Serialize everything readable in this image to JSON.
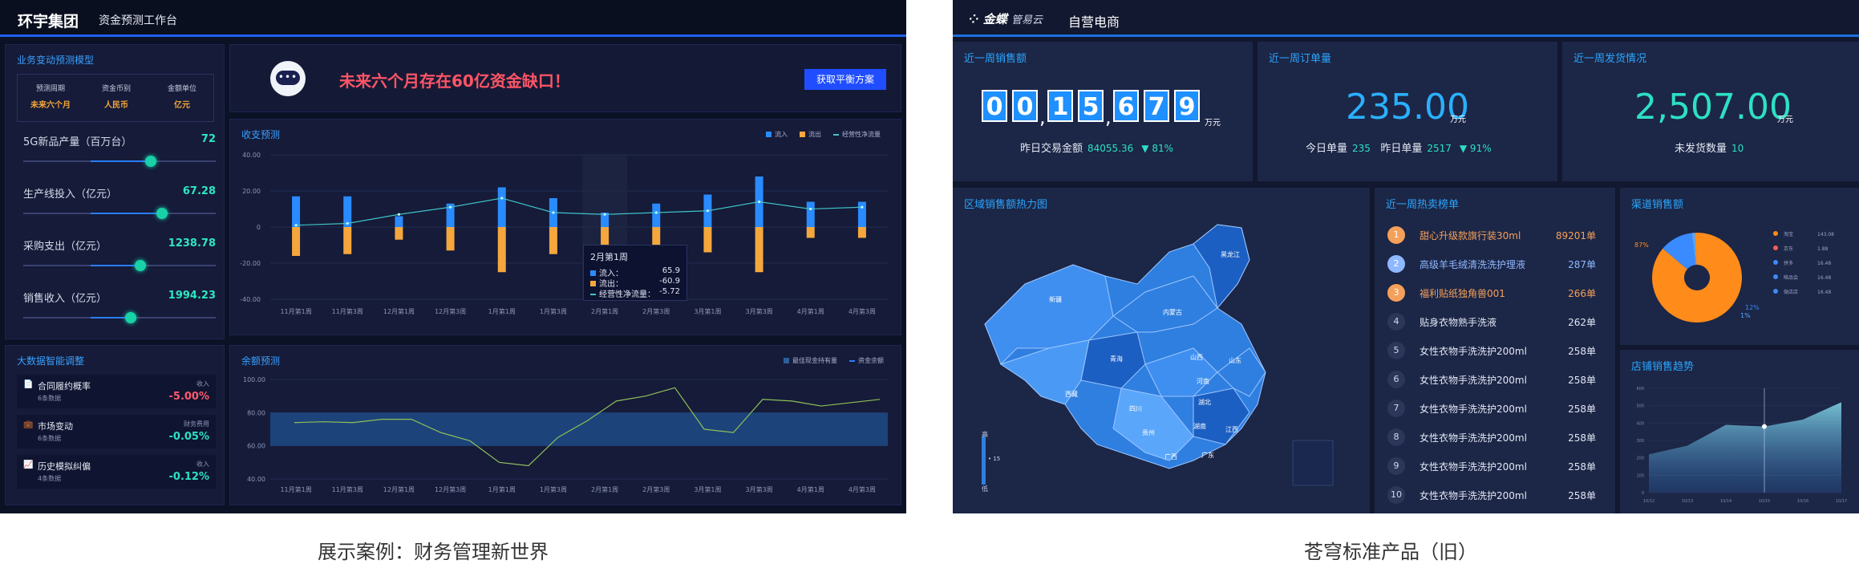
{
  "left": {
    "header": {
      "brand": "环宇集团",
      "subtitle": "资金预测工作台"
    },
    "model": {
      "title": "业务变动预测模型",
      "cols": [
        {
          "key": "预测周期",
          "val": "未来六个月"
        },
        {
          "key": "资金币别",
          "val": "人民币"
        },
        {
          "key": "金额单位",
          "val": "亿元"
        }
      ],
      "sliders": [
        {
          "label": "5G新品产量（百万台）",
          "value": "72",
          "level": 0.48
        },
        {
          "label": "生产线投入（亿元）",
          "value": "67.28",
          "level": 0.57
        },
        {
          "label": "采购支出（亿元）",
          "value": "1238.78",
          "level": 0.4
        },
        {
          "label": "销售收入（亿元）",
          "value": "1994.23",
          "level": 0.32
        }
      ]
    },
    "alert": {
      "icon": "•••",
      "message": "未来六个月存在60亿资金缺口！",
      "button": "获取平衡方案"
    },
    "revenue": {
      "title": "收支预测",
      "legend": [
        "流入",
        "流出",
        "经营性净流量"
      ]
    },
    "tooltip": {
      "title": "2月第1周",
      "rows": [
        {
          "label": "流入：",
          "value": "65.9"
        },
        {
          "label": "流出：",
          "value": "-60.9"
        },
        {
          "label": "经营性净流量：",
          "value": "-5.72"
        }
      ]
    },
    "adjust": {
      "title": "大数据智能调整",
      "items": [
        {
          "name": "合同履约概率",
          "count": "6条数据",
          "tag": "收入",
          "pct": "-5.00%",
          "color": "#ff5a6e",
          "icon": "📄"
        },
        {
          "name": "市场变动",
          "count": "6条数据",
          "tag": "财务费用",
          "pct": "-0.05%",
          "color": "#2de0c4",
          "icon": "💼"
        },
        {
          "name": "历史模拟纠偏",
          "count": "4条数据",
          "tag": "收入",
          "pct": "-0.12%",
          "color": "#2de0c4",
          "icon": "📈"
        }
      ]
    },
    "balance": {
      "title": "余额预测",
      "legend": [
        "最佳现金持有量",
        "资金余额"
      ]
    }
  },
  "chart_data": [
    {
      "type": "bar",
      "title": "收支预测",
      "categories": [
        "11月第1周",
        "11月第3周",
        "12月第1周",
        "12月第3周",
        "1月第1周",
        "1月第3周",
        "2月第1周",
        "2月第3周",
        "3月第1周",
        "3月第3周",
        "4月第1周",
        "4月第3周"
      ],
      "series": [
        {
          "name": "流入",
          "values": [
            17,
            17,
            6,
            13,
            22,
            16,
            8,
            13,
            18,
            28,
            14,
            14
          ]
        },
        {
          "name": "流出",
          "values": [
            -16,
            -15,
            -7,
            -13,
            -25,
            -15,
            -14,
            -12,
            -14,
            -25,
            -6,
            -6
          ]
        },
        {
          "name": "经营性净流量",
          "values": [
            1,
            2,
            7,
            11,
            16,
            8,
            7,
            8,
            9,
            14,
            10,
            11
          ]
        }
      ],
      "yticks": [
        "40.00",
        "20.00",
        "0",
        "-20.00",
        "-40.00"
      ],
      "ylim": [
        -40,
        40
      ]
    },
    {
      "type": "line",
      "title": "余额预测",
      "categories": [
        "11月第1周",
        "11月第3周",
        "12月第1周",
        "12月第3周",
        "1月第1周",
        "1月第3周",
        "2月第1周",
        "2月第3周",
        "3月第1周",
        "3月第3周",
        "4月第1周",
        "4月第3周"
      ],
      "series": [
        {
          "name": "资金余额",
          "values": [
            74,
            74.5,
            74,
            76,
            76,
            68,
            63,
            50,
            48,
            65,
            75,
            87,
            90,
            95,
            70,
            68,
            88,
            87,
            84,
            86,
            88
          ]
        }
      ],
      "band": [
        60,
        80
      ],
      "yticks": [
        "100.00",
        "80.00",
        "60.00",
        "40.00"
      ],
      "ylim": [
        40,
        100
      ]
    },
    {
      "type": "pie",
      "title": "渠道销售额",
      "values": [
        87,
        12,
        1
      ],
      "labels": [
        "87%",
        "12%",
        "1%"
      ],
      "legend": [
        {
          "name": "淘宝",
          "value": "143.08",
          "color": "#ff8c1a"
        },
        {
          "name": "京东",
          "value": "1.88",
          "color": "#ff5a5a"
        },
        {
          "name": "拼多",
          "value": "16.48",
          "color": "#3a8bff"
        },
        {
          "name": "唯品会",
          "value": "16.48",
          "color": "#3a8bff"
        },
        {
          "name": "微店店",
          "value": "16.48",
          "color": "#3a8bff"
        }
      ]
    },
    {
      "type": "area",
      "title": "店铺销售趋势",
      "categories": [
        "10/12",
        "10/13",
        "10/14",
        "10/15",
        "10/16",
        "10/17"
      ],
      "values": [
        220,
        270,
        390,
        380,
        420,
        520
      ],
      "yticks": [
        "600",
        "500",
        "400",
        "300",
        "200",
        "100",
        "0"
      ],
      "ylim": [
        0,
        600
      ]
    }
  ],
  "right": {
    "header": {
      "logo": "金蝶",
      "logo_sub": "管易云",
      "app": "自营电商"
    },
    "sales": {
      "title": "近一周销售额",
      "digits": [
        "0",
        "0",
        "1",
        "5",
        "6",
        "7",
        "9"
      ],
      "unit": "万元",
      "sub_label": "昨日交易金额",
      "sub_value": "84055.36",
      "sub_up": "▼ 81%"
    },
    "orders": {
      "title": "近一周订单量",
      "value": "235.00",
      "unit": "万元",
      "today_label": "今日单量",
      "today_value": "235",
      "yest_label": "昨日单量",
      "yest_value": "2517",
      "up": "▼ 91%"
    },
    "shipping": {
      "title": "近一周发货情况",
      "value": "2,507.00",
      "unit": "万元",
      "sub_label": "未发货数量",
      "sub_value": "10"
    },
    "heatmap": {
      "title": "区域销售额热力图",
      "legend_high": "高",
      "legend_low": "低",
      "legend_mark": "• 15",
      "regions": [
        "新疆",
        "西藏",
        "青海",
        "内蒙古",
        "四川",
        "湖北",
        "广西",
        "广东",
        "江西",
        "湖南",
        "山东",
        "山西",
        "河南",
        "贵州",
        "黑龙江"
      ]
    },
    "hot": {
      "title": "近一周热卖榜单",
      "items": [
        {
          "no": "1",
          "name": "甜心升级款旗行装30ml",
          "qty": "89201单",
          "color": "#f5a05a"
        },
        {
          "no": "2",
          "name": "高级羊毛绒清洗洗护理液",
          "qty": "287单",
          "color": "#8fb8ff"
        },
        {
          "no": "3",
          "name": "福利贴纸独角兽001",
          "qty": "266单",
          "color": "#f5a05a"
        },
        {
          "no": "4",
          "name": "贴身衣物熟手洗液",
          "qty": "262单",
          "color": "#e2e7f4"
        },
        {
          "no": "5",
          "name": "女性衣物手洗洗护200ml",
          "qty": "258单",
          "color": "#e2e7f4"
        },
        {
          "no": "6",
          "name": "女性衣物手洗洗护200ml",
          "qty": "258单",
          "color": "#e2e7f4"
        },
        {
          "no": "7",
          "name": "女性衣物手洗洗护200ml",
          "qty": "258单",
          "color": "#e2e7f4"
        },
        {
          "no": "8",
          "name": "女性衣物手洗洗护200ml",
          "qty": "258单",
          "color": "#e2e7f4"
        },
        {
          "no": "9",
          "name": "女性衣物手洗洗护200ml",
          "qty": "258单",
          "color": "#e2e7f4"
        },
        {
          "no": "10",
          "name": "女性衣物手洗洗护200ml",
          "qty": "258单",
          "color": "#e2e7f4"
        }
      ]
    },
    "channel": {
      "title": "渠道销售额"
    },
    "trend": {
      "title": "店铺销售趋势"
    }
  },
  "captions": {
    "left": "展示案例：财务管理新世界",
    "right": "苍穹标准产品（旧）"
  }
}
